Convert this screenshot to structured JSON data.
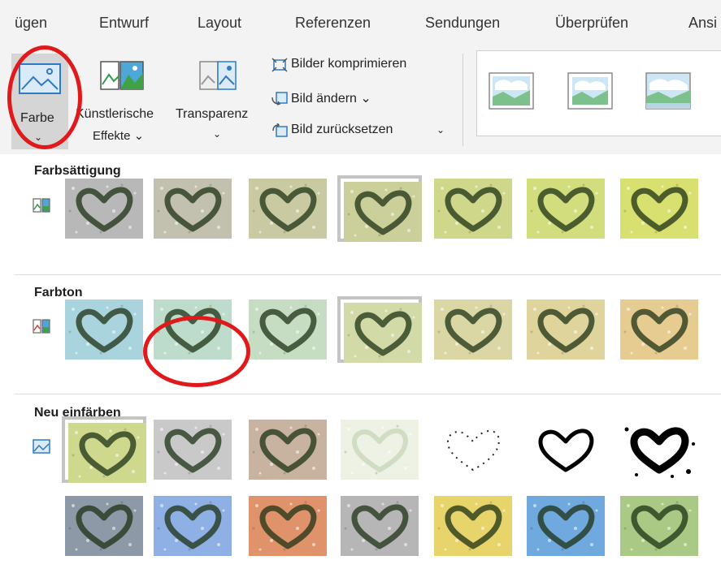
{
  "tabs": [
    "ügen",
    "Entwurf",
    "Layout",
    "Referenzen",
    "Sendungen",
    "Überprüfen",
    "Ansi"
  ],
  "ribbon": {
    "farbe": {
      "label": "Farbe",
      "chevron": "⌄"
    },
    "kuenstlerische": {
      "line1": "Künstlerische",
      "line2": "Effekte ⌄"
    },
    "transparenz": {
      "label": "Transparenz",
      "chevron": "⌄"
    },
    "bilder_komprimieren": "Bilder komprimieren",
    "bild_aendern": "Bild ändern ⌄",
    "bild_zuruecksetzen": "Bild zurücksetzen",
    "bild_zuruecksetzen_chevron": "⌄",
    "styles": [
      "picture-style-1",
      "picture-style-2",
      "picture-style-3"
    ]
  },
  "panel": {
    "sections": [
      {
        "title": "Farbsättigung",
        "icon": "saturation-options-icon",
        "rows": [
          [
            "#b8b8b8",
            "#c2c0ae",
            "#c9caa1",
            "#cbd09a",
            "#cfd88a",
            "#d2de7e",
            "#d8e070"
          ]
        ],
        "selected": [
          3
        ]
      },
      {
        "title": "Farbton",
        "icon": "tone-options-icon",
        "rows": [
          [
            "#a9d4dd",
            "#bddccc",
            "#c6ddc4",
            "#d2dba8",
            "#dad7a5",
            "#e0d49d",
            "#e7cc92"
          ]
        ],
        "selected": [
          3
        ]
      },
      {
        "title": "Neu einfärben",
        "icon": "recolor-options-icon",
        "rows": [
          [
            "#cfd98e",
            "#c9c9c9",
            "#c7b3a0",
            "#eef2e4",
            "#ffffff",
            "#ffffff",
            "#ffffff"
          ],
          [
            "#8e99a8",
            "#8fb0e4",
            "#e0936b",
            "#b6b6b6",
            "#e7d46a",
            "#6fa9de",
            "#a9c985"
          ]
        ],
        "selected": [
          0
        ]
      }
    ]
  },
  "colors": {
    "highlight": "#e01a1a",
    "ribbon_bg": "#f3f3f3",
    "selected_border": "#c4c4c4"
  }
}
